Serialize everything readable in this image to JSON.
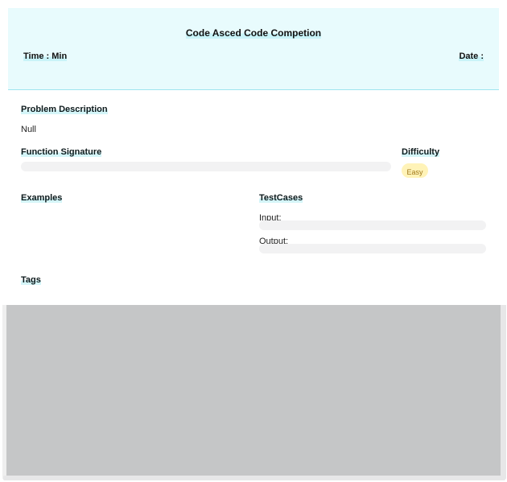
{
  "header": {
    "title": "Code Asced Code Competion",
    "time_label": "Time : Min",
    "date_label": "Date :",
    "bg_color": "#e8fbfd"
  },
  "problem": {
    "description_label": "Problem Description",
    "description_value": "Null"
  },
  "function_signature": {
    "label": "Function Signature"
  },
  "difficulty": {
    "label": "Difficulty",
    "value": "Easy",
    "color": "#fff3b8"
  },
  "examples": {
    "label": "Examples"
  },
  "testcases": {
    "label": "TestCases",
    "input_label": "Input:",
    "output_label": "Output:"
  },
  "tags": {
    "label": "Tags"
  }
}
